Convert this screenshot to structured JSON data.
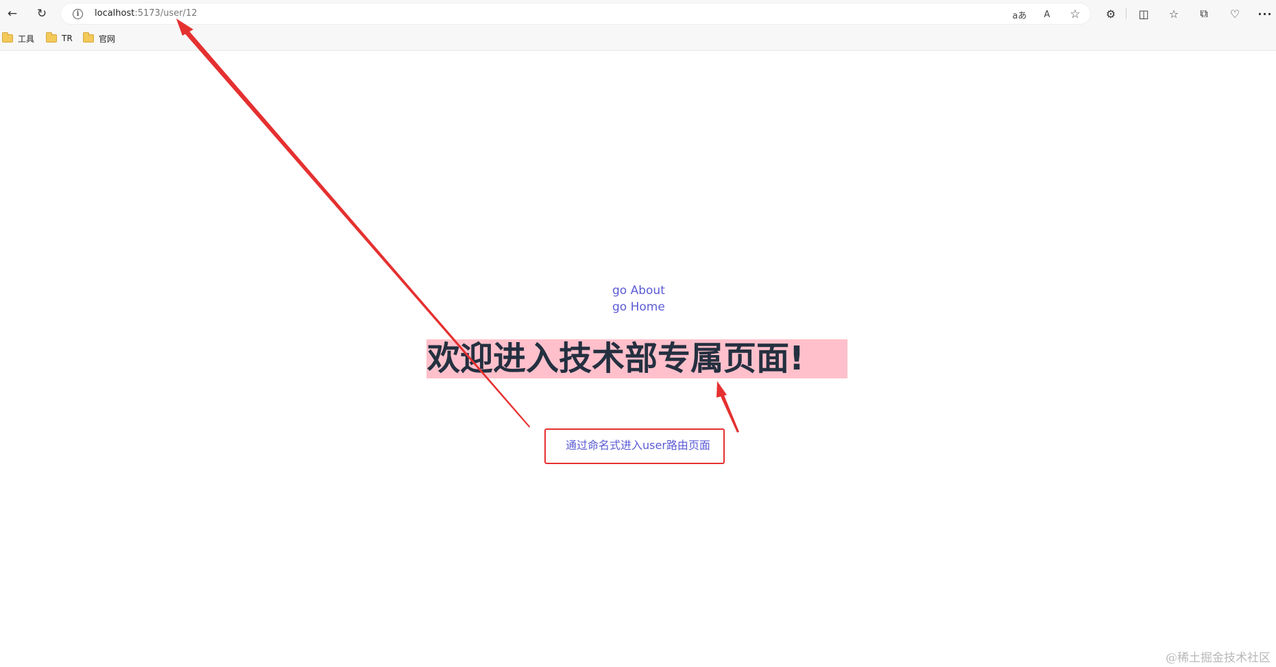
{
  "browser": {
    "url_host": "localhost",
    "url_path": ":5173/user/12",
    "back_glyph": "←",
    "reload_glyph": "↻",
    "info_glyph": "i",
    "read_glyph": "aあ",
    "read_aloud_glyph": "A",
    "favorite_glyph": "☆",
    "extensions_glyph": "⚙",
    "split_glyph": "◫",
    "favorites_glyph": "☆",
    "collections_glyph": "⧉",
    "health_glyph": "♡",
    "more_glyph": "···"
  },
  "bookmarks": [
    {
      "label": "工具"
    },
    {
      "label": "TR"
    },
    {
      "label": "官网"
    }
  ],
  "page": {
    "links": [
      {
        "label": "go About"
      },
      {
        "label": "go Home"
      }
    ],
    "heading": "欢迎进入技术部专属页面!",
    "route_link": "通过命名式进入user路由页面"
  },
  "watermark": "@稀土掘金技术社区",
  "colors": {
    "link": "#5b5bd6",
    "heading_bg": "#ffc0cb",
    "heading_text": "#243040",
    "annotation": "#e53030"
  }
}
